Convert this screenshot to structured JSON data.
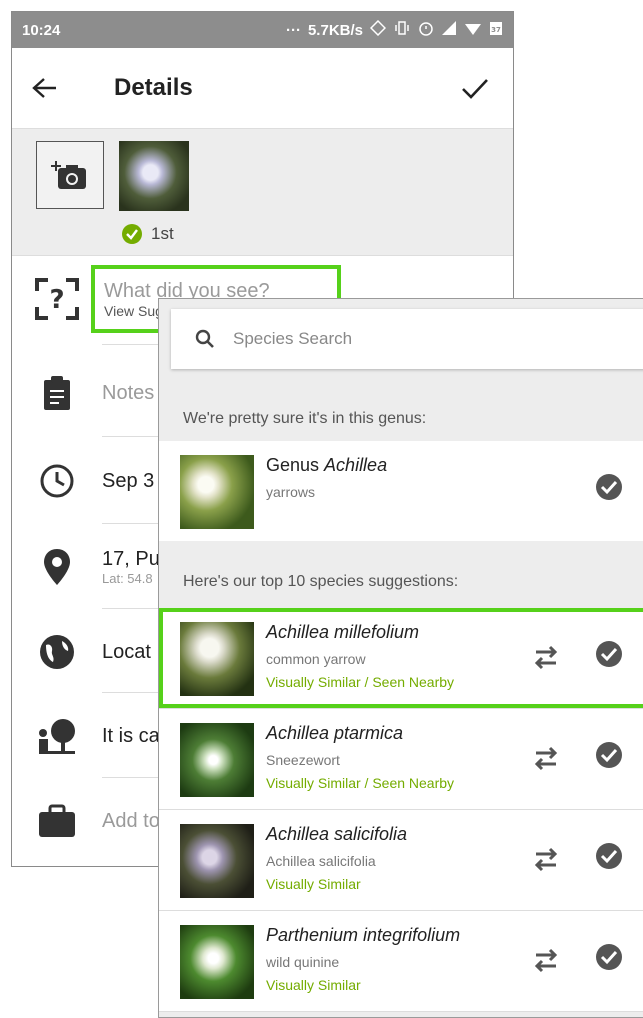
{
  "status": {
    "time": "10:24",
    "dots": "···",
    "speed": "5.7KB/s",
    "battery": "37"
  },
  "header": {
    "title": "Details"
  },
  "photos": {
    "rank": "1st"
  },
  "fields": {
    "what_placeholder": "What did you see?",
    "view_suggestions": "View Suggestions",
    "notes_placeholder": "Notes",
    "date": "Sep 3",
    "place": "17, Pu",
    "latlng": "Lat: 54.8",
    "location_visibility": "Locat",
    "captive": "It is ca",
    "projects": "Add to"
  },
  "overlay": {
    "search_placeholder": "Species Search",
    "genus_heading": "We're pretty sure it's in this genus:",
    "genus": {
      "prefix": "Genus ",
      "name": "Achillea",
      "common": "yarrows"
    },
    "species_heading": "Here's our top 10 species suggestions:",
    "suggestions": [
      {
        "name": "Achillea millefolium",
        "common": "common yarrow",
        "tag": "Visually Similar / Seen Nearby"
      },
      {
        "name": "Achillea ptarmica",
        "common": "Sneezewort",
        "tag": "Visually Similar / Seen Nearby"
      },
      {
        "name": "Achillea salicifolia",
        "common": "Achillea salicifolia",
        "tag": "Visually Similar"
      },
      {
        "name": "Parthenium integrifolium",
        "common": "wild quinine",
        "tag": "Visually Similar"
      }
    ]
  },
  "colors": {
    "highlight": "#56d11a",
    "tag_green": "#74ac00",
    "statusbar": "#8d8d8d",
    "check_green": "#74ac00"
  },
  "icons": [
    "back-arrow-icon",
    "checkmark-icon",
    "add-photo-icon",
    "check-circle-icon",
    "species-unknown-icon",
    "clipboard-icon",
    "clock-icon",
    "location-pin-icon",
    "globe-icon",
    "tree-person-icon",
    "briefcase-icon",
    "search-icon",
    "compare-swap-icon"
  ]
}
